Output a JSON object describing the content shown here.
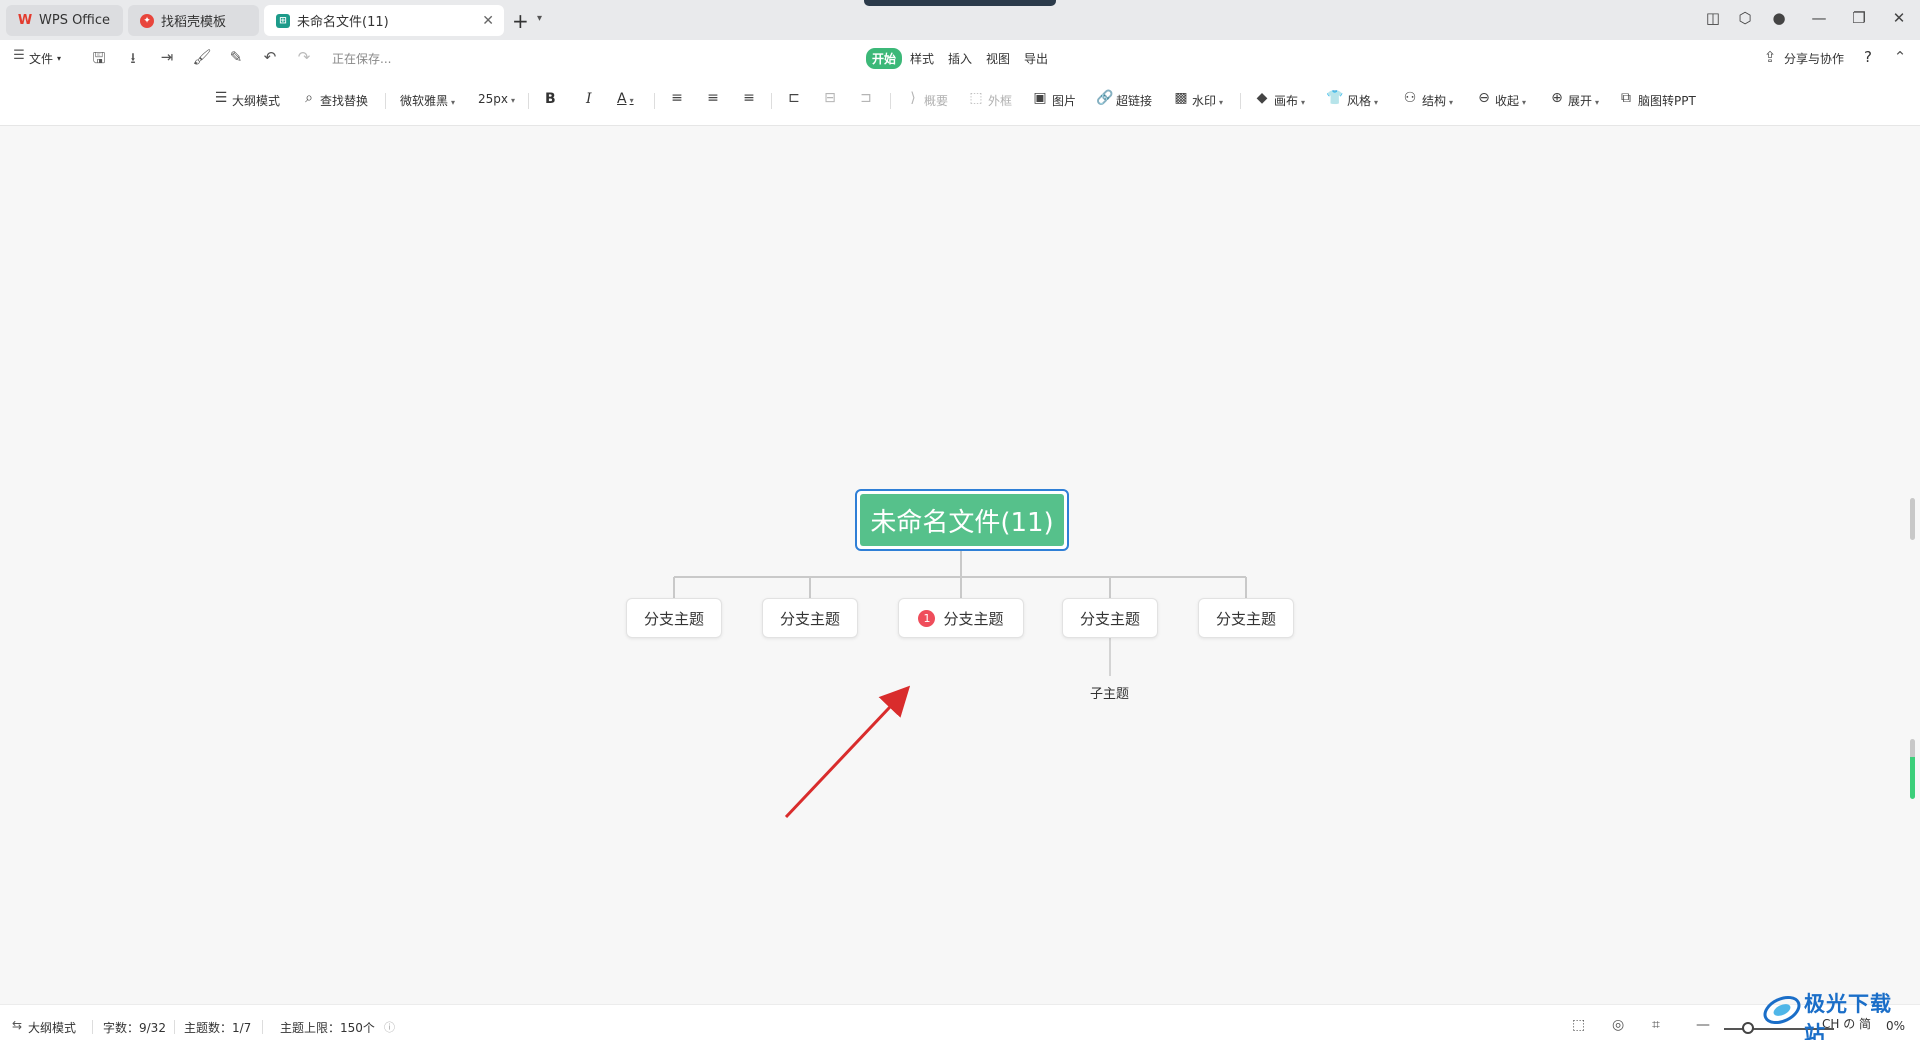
{
  "tabs": [
    {
      "label": "WPS Office"
    },
    {
      "label": "找稻壳模板"
    },
    {
      "label": "未命名文件(11)"
    }
  ],
  "menu": {
    "file": "文件",
    "saving": "正在保存...",
    "tabs": [
      "开始",
      "样式",
      "插入",
      "视图",
      "导出"
    ],
    "share": "分享与协作",
    "help": "?"
  },
  "toolbar": {
    "outline": "大纲模式",
    "find_replace": "查找替换",
    "font": "微软雅黑",
    "size": "25px",
    "bold": "B",
    "italic": "I",
    "font_color": "A",
    "summary": "概要",
    "frame": "外框",
    "image": "图片",
    "hyperlink": "超链接",
    "watermark": "水印",
    "canvas": "画布",
    "style": "风格",
    "structure": "结构",
    "collapse": "收起",
    "expand": "展开",
    "to_ppt": "脑图转PPT"
  },
  "mindmap": {
    "root": "未命名文件(11)",
    "branches": [
      {
        "label": "分支主题"
      },
      {
        "label": "分支主题"
      },
      {
        "label": "分支主题",
        "badge": "1"
      },
      {
        "label": "分支主题"
      },
      {
        "label": "分支主题"
      }
    ],
    "subtopic": "子主题"
  },
  "status": {
    "outline": "大纲模式",
    "word_count": "字数：9/32",
    "topic_count": "主题数：1/7",
    "topic_limit": "主题上限：150个",
    "zoom_suffix": "0%"
  },
  "watermark": {
    "name": "极光下载站",
    "url": "CH の 简"
  },
  "colors": {
    "accent_green": "#3cb878",
    "root_fill": "#56c18b",
    "selection_border": "#2f7fd6",
    "badge_red": "#ef4d5b",
    "arrow_red": "#d92c2c"
  }
}
